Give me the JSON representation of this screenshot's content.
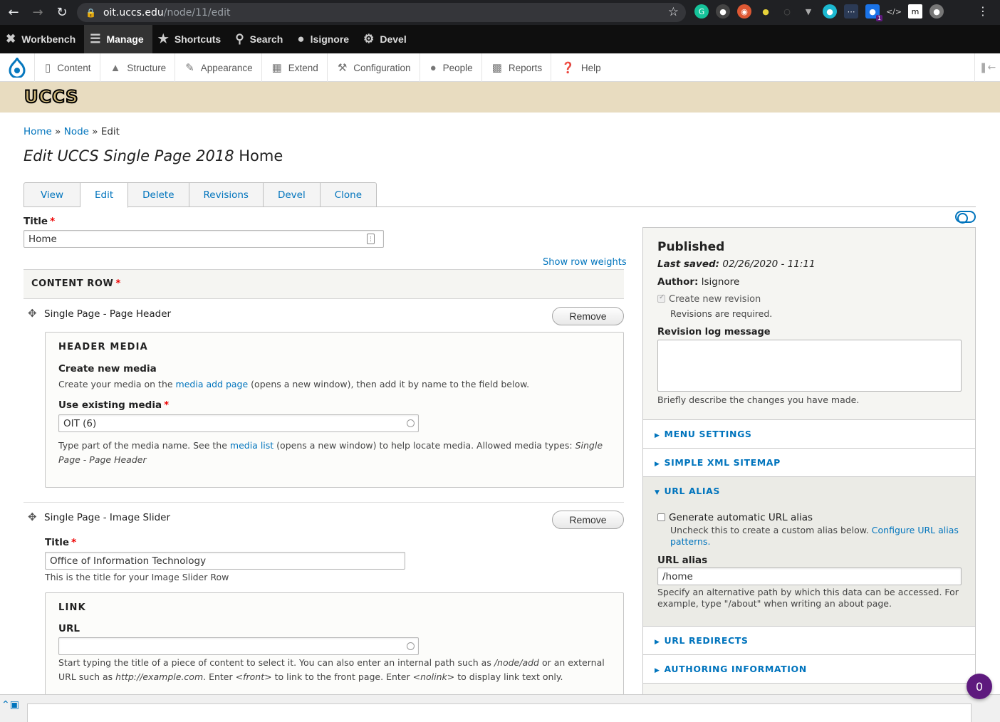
{
  "browser": {
    "url_host": "oit.uccs.edu",
    "url_path": "/node/11/edit",
    "ext_badge": "1"
  },
  "admin_toolbar": {
    "items": [
      {
        "label": "Workbench",
        "icon": "wrench-cross-icon"
      },
      {
        "label": "Manage",
        "icon": "menu-icon"
      },
      {
        "label": "Shortcuts",
        "icon": "star-icon"
      },
      {
        "label": "Search",
        "icon": "search-icon"
      },
      {
        "label": "lsignore",
        "icon": "user-icon"
      },
      {
        "label": "Devel",
        "icon": "gear-icon"
      }
    ]
  },
  "admin_tray": {
    "items": [
      {
        "label": "Content",
        "icon": "page-icon"
      },
      {
        "label": "Structure",
        "icon": "sitemap-icon"
      },
      {
        "label": "Appearance",
        "icon": "brush-icon"
      },
      {
        "label": "Extend",
        "icon": "puzzle-icon"
      },
      {
        "label": "Configuration",
        "icon": "wrench-icon"
      },
      {
        "label": "People",
        "icon": "people-icon"
      },
      {
        "label": "Reports",
        "icon": "bar-chart-icon"
      },
      {
        "label": "Help",
        "icon": "help-icon"
      }
    ]
  },
  "banner": {
    "logo_text": "UCCS"
  },
  "breadcrumb": {
    "home": "Home",
    "sep1": "»",
    "node": "Node",
    "sep2": "»",
    "edit": "Edit"
  },
  "page": {
    "title_type": "Edit UCCS Single Page 2018",
    "title_node": "Home"
  },
  "tabs": [
    "View",
    "Edit",
    "Delete",
    "Revisions",
    "Devel",
    "Clone"
  ],
  "form": {
    "title_label": "Title",
    "required_mark": "*",
    "title_value": "Home",
    "show_row_weights": "Show row weights",
    "content_row_label": "CONTENT ROW",
    "remove_label": "Remove",
    "row1": {
      "name": "Single Page - Page Header",
      "header_media_legend": "HEADER MEDIA",
      "create_new_media_label": "Create new media",
      "create_desc_pre": "Create your media on the",
      "create_desc_link": "media add page",
      "create_desc_post": "(opens a new window), then add it by name to the field below.",
      "use_existing_label": "Use existing media",
      "use_existing_value": "OIT (6)",
      "media_desc_pre": "Type part of the media name. See the",
      "media_desc_link": "media list",
      "media_desc_mid": "(opens a new window) to help locate media. Allowed media types:",
      "media_desc_em": "Single Page - Page Header"
    },
    "row2": {
      "name": "Single Page - Image Slider",
      "title_label": "Title",
      "title_value": "Office of Information Technology",
      "title_desc": "This is the title for your Image Slider Row",
      "link_legend": "LINK",
      "url_label": "URL",
      "url_value": "",
      "url_desc_1": "Start typing the title of a piece of content to select it. You can also enter an internal path such as",
      "url_desc_em1": "/node/add",
      "url_desc_2": "or an external URL such as",
      "url_desc_em2": "http://example.com",
      "url_desc_3": ". Enter",
      "url_desc_em3": "<front>",
      "url_desc_4": "to link to the front page. Enter",
      "url_desc_em4": "<nolink>",
      "url_desc_5": "to display link text only."
    }
  },
  "sidebar": {
    "status": "Published",
    "last_saved_label": "Last saved:",
    "last_saved_value": "02/26/2020 - 11:11",
    "author_label": "Author:",
    "author_value": "lsignore",
    "create_revision_label": "Create new revision",
    "revisions_required": "Revisions are required.",
    "revision_log_label": "Revision log message",
    "revision_log_value": "",
    "revision_log_desc": "Briefly describe the changes you have made.",
    "menu_settings": "MENU SETTINGS",
    "simple_xml_sitemap": "SIMPLE XML SITEMAP",
    "url_alias_heading": "URL ALIAS",
    "generate_alias_label": "Generate automatic URL alias",
    "generate_alias_desc": "Uncheck this to create a custom alias below.",
    "configure_alias_link": "Configure URL alias patterns.",
    "url_alias_label": "URL alias",
    "url_alias_value": "/home",
    "url_alias_desc": "Specify an alternative path by which this data can be accessed. For example, type \"/about\" when writing an about page.",
    "url_redirects": "URL REDIRECTS",
    "authoring_information": "AUTHORING INFORMATION"
  },
  "chat": {
    "count": "0"
  },
  "colors": {
    "link": "#0074bd",
    "banner": "#e8dcc0",
    "toolbar": "#0f0f0f",
    "chat": "#5e1a7e"
  }
}
